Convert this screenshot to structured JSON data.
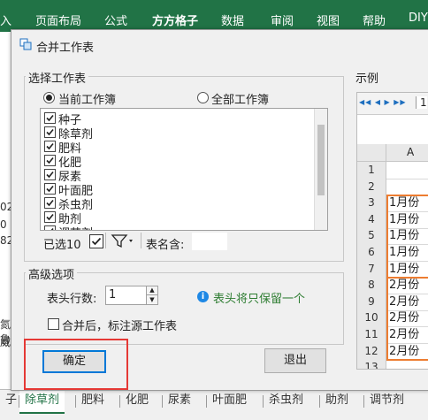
{
  "ribbon": {
    "tabs": [
      {
        "label": "入",
        "bold": false
      },
      {
        "label": "页面布局",
        "bold": false
      },
      {
        "label": "公式",
        "bold": false
      },
      {
        "label": "方方格子",
        "bold": true
      },
      {
        "label": "数据",
        "bold": false
      },
      {
        "label": "审阅",
        "bold": false
      },
      {
        "label": "视图",
        "bold": false
      },
      {
        "label": "帮助",
        "bold": false
      },
      {
        "label": "DIY",
        "bold": false
      }
    ]
  },
  "background_cells": [
    "02",
    "0",
    "82",
    "氮鲁",
    "威"
  ],
  "dialog": {
    "title": "合并工作表",
    "select_sheets": {
      "label": "选择工作表",
      "radio_current": "当前工作簿",
      "radio_all": "全部工作簿",
      "selected_radio": "current",
      "items": [
        "种子",
        "除草剂",
        "肥料",
        "化肥",
        "尿素",
        "叶面肥",
        "杀虫剂",
        "助剂",
        "调节剂"
      ],
      "selected_count_label": "已选10",
      "sheet_name_label": "表名含:",
      "sheet_name_value": ""
    },
    "advanced": {
      "label": "高级选项",
      "header_rows_label": "表头行数:",
      "header_rows_value": "1",
      "info_text": "表头将只保留一个",
      "mark_source_label": "合并后，标注源工作表"
    },
    "buttons": {
      "ok": "确定",
      "cancel": "退出"
    },
    "preview": {
      "label": "示例",
      "sheet_tab_text": "1",
      "column_a": "A",
      "rows": [
        {
          "num": "1",
          "value": ""
        },
        {
          "num": "2",
          "value": ""
        },
        {
          "num": "3",
          "value": "1月份"
        },
        {
          "num": "4",
          "value": "1月份"
        },
        {
          "num": "5",
          "value": "1月份"
        },
        {
          "num": "6",
          "value": "1月份"
        },
        {
          "num": "7",
          "value": "1月份"
        },
        {
          "num": "8",
          "value": "2月份"
        },
        {
          "num": "9",
          "value": "2月份"
        },
        {
          "num": "10",
          "value": "2月份"
        },
        {
          "num": "11",
          "value": "2月份"
        },
        {
          "num": "12",
          "value": "2月份"
        },
        {
          "num": "13",
          "value": ""
        }
      ],
      "highlight_color": "#ed7d31"
    }
  },
  "sheet_tabs": {
    "items": [
      "子",
      "除草剂",
      "肥料",
      "化肥",
      "尿素",
      "叶面肥",
      "杀虫剂",
      "助剂",
      "调节剂"
    ],
    "active": "除草剂"
  },
  "colors": {
    "excel_green": "#217346",
    "highlight_red": "#e53935",
    "accent_blue": "#0078d7"
  }
}
